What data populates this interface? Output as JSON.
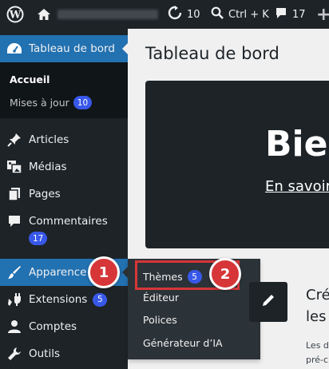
{
  "admin_bar": {
    "updates_count": "10",
    "search_shortcut": "Ctrl + K",
    "comments_count": "17",
    "new_label": "+"
  },
  "sidebar": {
    "dashboard": {
      "label": "Tableau de bord",
      "icon": "dashboard-icon"
    },
    "submenu": {
      "home": "Accueil",
      "updates": "Mises à jour",
      "updates_badge": "10"
    },
    "items": [
      {
        "label": "Articles",
        "icon": "pin-icon"
      },
      {
        "label": "Médias",
        "icon": "media-icon"
      },
      {
        "label": "Pages",
        "icon": "pages-icon"
      },
      {
        "label": "Commentaires",
        "icon": "comment-icon",
        "badge": "17"
      },
      {
        "label": "Apparence",
        "icon": "brush-icon"
      },
      {
        "label": "Extensions",
        "icon": "plugin-icon",
        "badge": "5"
      },
      {
        "label": "Comptes",
        "icon": "user-icon"
      },
      {
        "label": "Outils",
        "icon": "wrench-icon"
      }
    ]
  },
  "flyout": {
    "themes": "Thèmes",
    "themes_badge": "5",
    "editor": "Éditeur",
    "fonts": "Polices",
    "ai": "Générateur d’IA"
  },
  "steps": {
    "one": "1",
    "two": "2"
  },
  "main": {
    "title": "Tableau de bord",
    "welcome_heading": "Bien",
    "welcome_link": "En savoir",
    "create_heading_1": "Cré",
    "create_heading_2": "les",
    "create_text_1": "Les d",
    "create_text_2": "pré-c"
  },
  "colors": {
    "admin_bg": "#1d2327",
    "accent": "#2271b1",
    "highlight": "#d63638",
    "badge": "#3858e9"
  }
}
